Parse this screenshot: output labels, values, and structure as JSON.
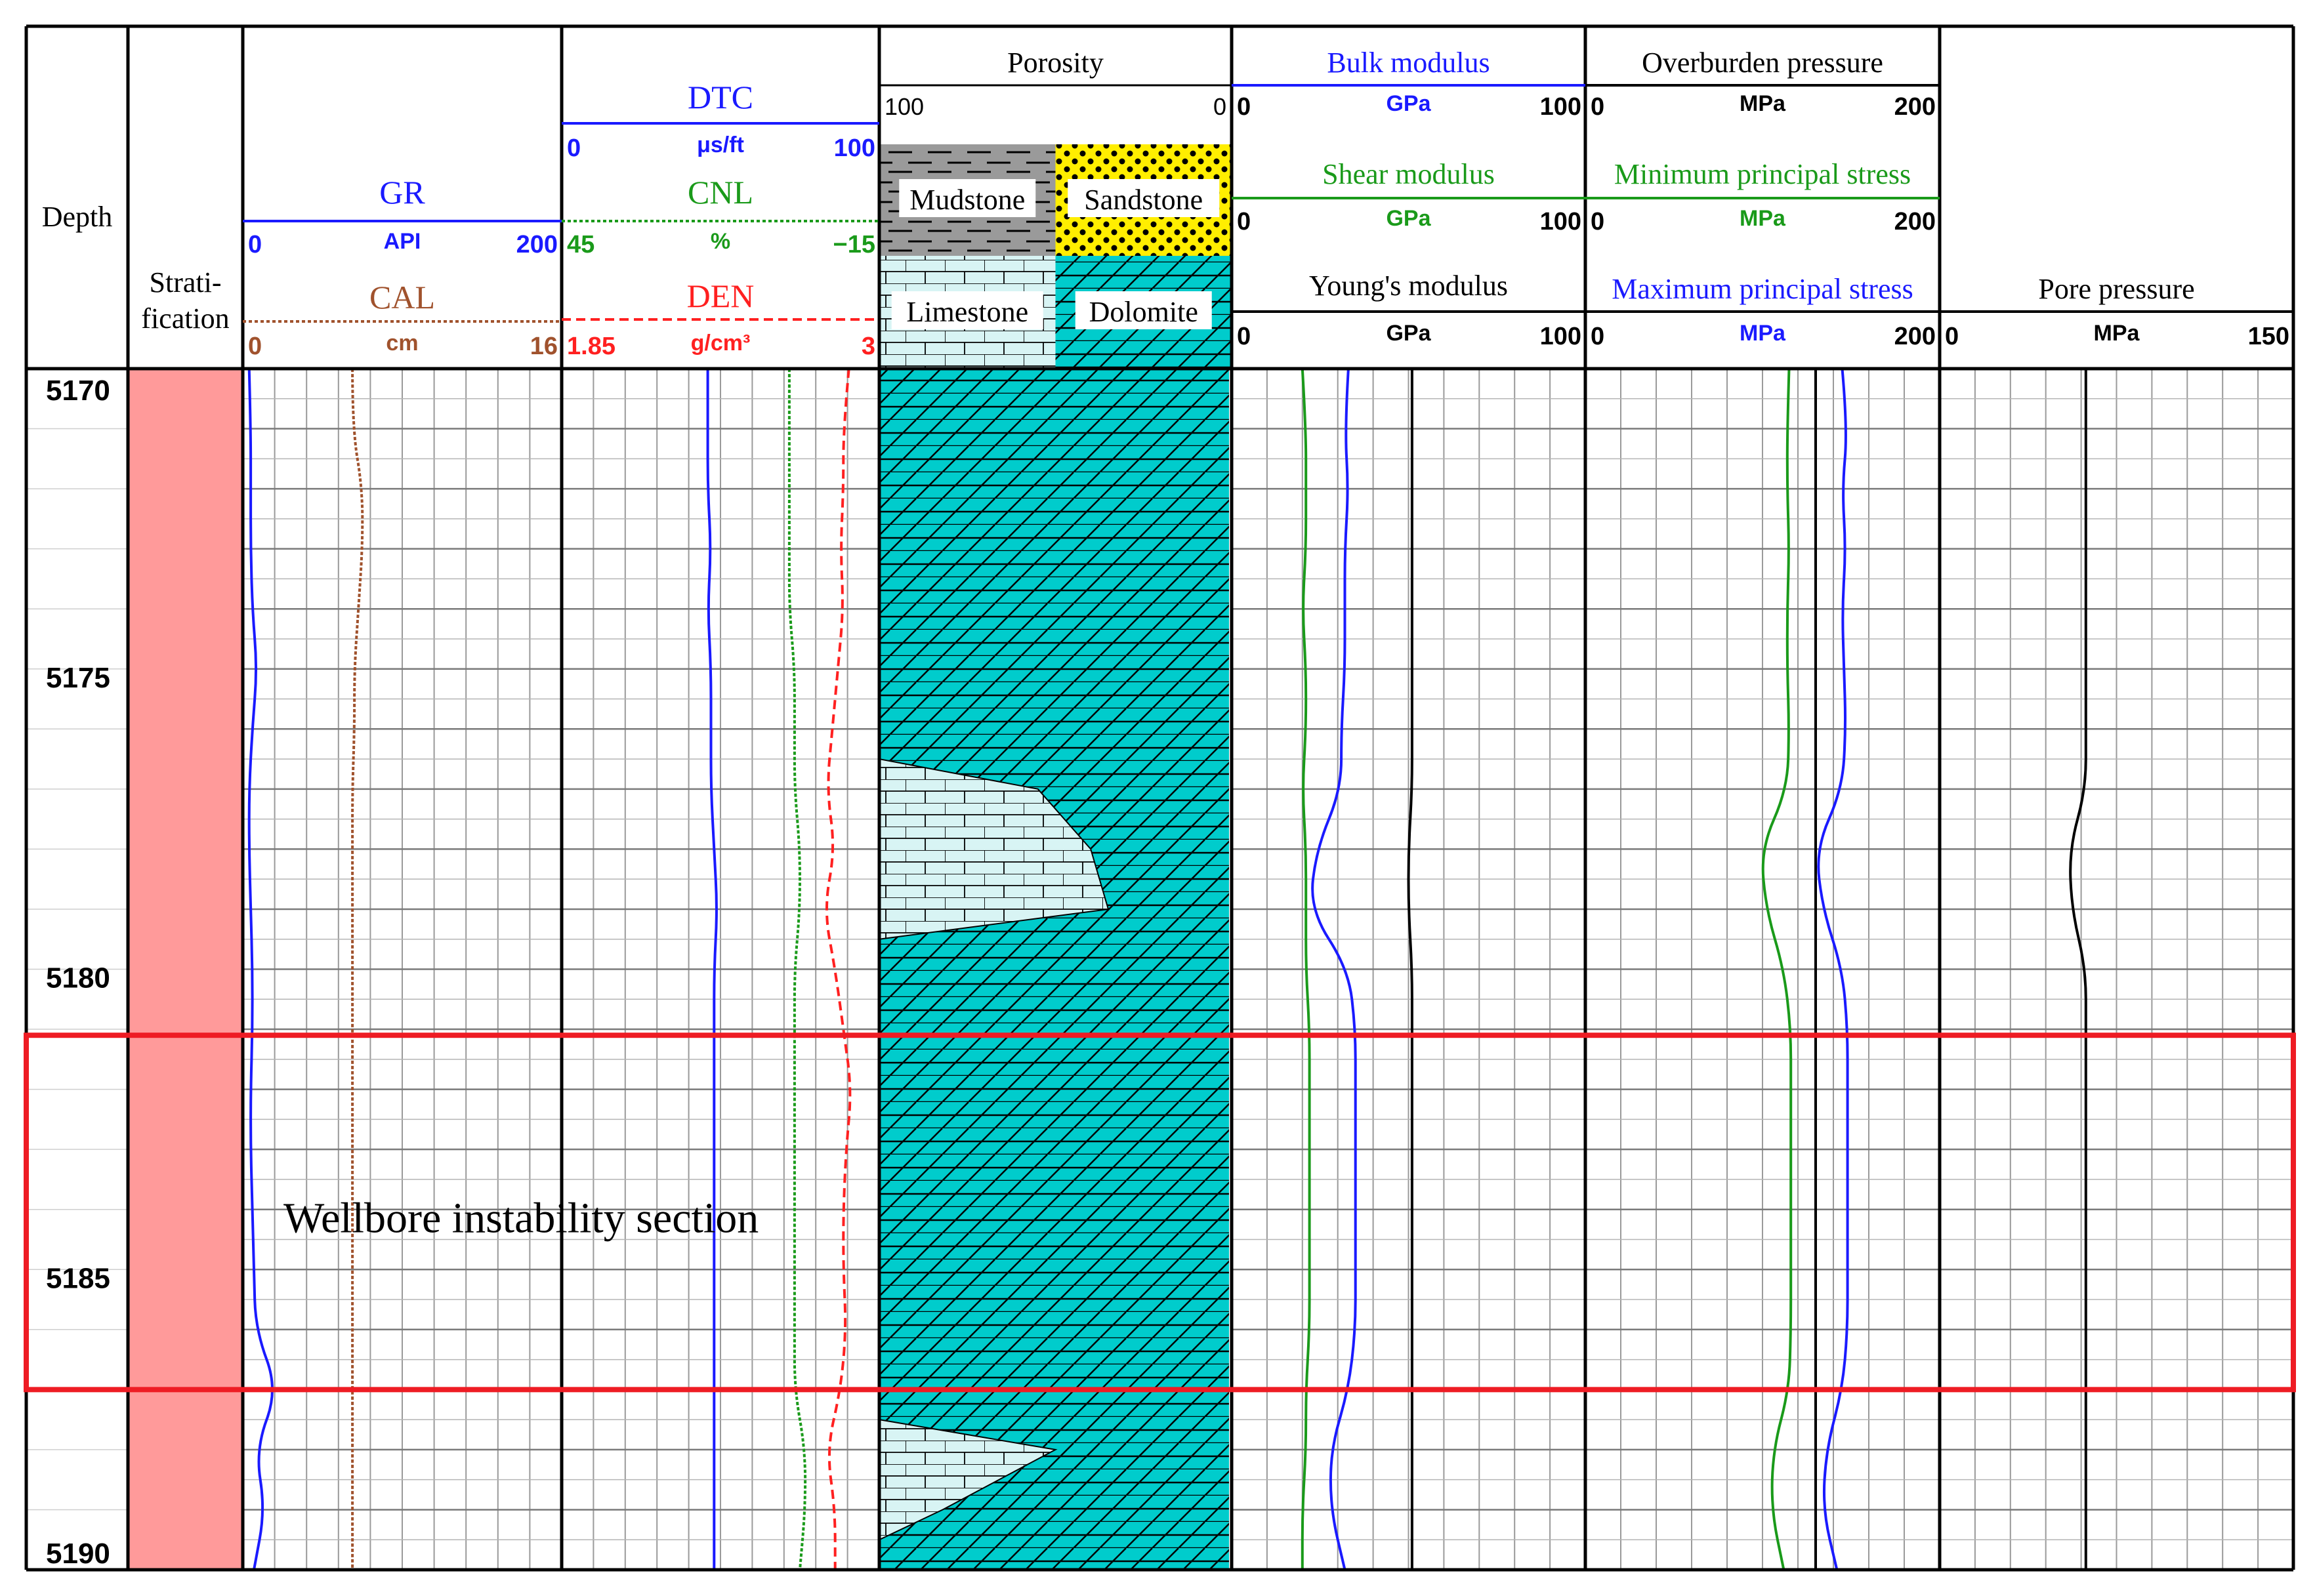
{
  "colors": {
    "gr": "#1a1aff",
    "cal": "#a0522d",
    "dtc": "#1a1aff",
    "cnl": "#1a9a1a",
    "den": "#ff2020",
    "bulk": "#1a1aff",
    "shear": "#1a9a1a",
    "young": "#000000",
    "overburden": "#000000",
    "min_stress": "#1a9a1a",
    "max_stress": "#1a1aff",
    "pore": "#000000",
    "stratification": "#ff9a9a",
    "dolomite_fill": "#00cccc",
    "limestone_fill": "#d8f4f4",
    "mudstone_fill": "#9a9a9a",
    "sandstone_fill": "#ffee00",
    "highlight_box": "#ee1c24"
  },
  "headers": {
    "depth": "Depth",
    "stratification": "Strati-\nfication",
    "porosity": "Porosity",
    "porosity_left": "100",
    "porosity_right": "0",
    "gr": {
      "name": "GR",
      "min": "0",
      "unit": "API",
      "max": "200"
    },
    "cal": {
      "name": "CAL",
      "min": "0",
      "unit": "cm",
      "max": "16"
    },
    "dtc": {
      "name": "DTC",
      "min": "0",
      "unit": "μs/ft",
      "max": "100"
    },
    "cnl": {
      "name": "CNL",
      "min": "45",
      "unit": "%",
      "max": "−15"
    },
    "den": {
      "name": "DEN",
      "min": "1.85",
      "unit": "g/cm³",
      "max": "3"
    },
    "bulk": {
      "name": "Bulk modulus",
      "min": "0",
      "unit": "GPa",
      "max": "100"
    },
    "shear": {
      "name": "Shear modulus",
      "min": "0",
      "unit": "GPa",
      "max": "100"
    },
    "young": {
      "name": "Young's modulus",
      "min": "0",
      "unit": "GPa",
      "max": "100"
    },
    "overburden": {
      "name": "Overburden pressure",
      "min": "0",
      "unit": "MPa",
      "max": "200"
    },
    "min_stress": {
      "name": "Minimum principal stress",
      "min": "0",
      "unit": "MPa",
      "max": "200"
    },
    "max_stress": {
      "name": "Maximum principal stress",
      "min": "0",
      "unit": "MPa",
      "max": "200"
    },
    "pore": {
      "name": "Pore pressure",
      "min": "0",
      "unit": "MPa",
      "max": "150"
    }
  },
  "lithology_legend": [
    "Mudstone",
    "Sandstone",
    "Limestone",
    "Dolomite"
  ],
  "annotation": "Wellbore instability section",
  "chart_data": {
    "type": "line",
    "y_axis": {
      "label": "Depth",
      "range": [
        5170,
        5190
      ],
      "ticks": [
        5170,
        5175,
        5180,
        5185,
        5190
      ]
    },
    "highlight_interval": {
      "label": "Wellbore instability section",
      "top": 5181.1,
      "bottom": 5187.0
    },
    "stratification": {
      "top": 5170,
      "bottom": 5190
    },
    "depth": [
      5170,
      5171,
      5172,
      5173,
      5174,
      5175,
      5176,
      5177,
      5178,
      5179,
      5180,
      5181,
      5182,
      5183,
      5184,
      5185,
      5186,
      5187,
      5188,
      5189,
      5190
    ],
    "series": [
      {
        "name": "GR",
        "track": "gr",
        "unit": "API",
        "range": [
          0,
          200
        ],
        "values": [
          4,
          5,
          5,
          5,
          6,
          9,
          6,
          4,
          4,
          5,
          6,
          6,
          5,
          5,
          6,
          7,
          8,
          22,
          8,
          14,
          7
        ]
      },
      {
        "name": "CAL",
        "track": "gr",
        "unit": "cm",
        "range": [
          0,
          16
        ],
        "values": [
          5.5,
          5.5,
          6.0,
          6.0,
          5.8,
          5.6,
          5.6,
          5.5,
          5.5,
          5.5,
          5.5,
          5.5,
          5.5,
          5.5,
          5.5,
          5.5,
          5.5,
          5.5,
          5.5,
          5.5,
          5.5
        ]
      },
      {
        "name": "DTC",
        "track": "dtc",
        "unit": "μs/ft",
        "range": [
          0,
          100
        ],
        "values": [
          46,
          46,
          46,
          47,
          46,
          47,
          47,
          47,
          48,
          49,
          48,
          48,
          48,
          48,
          48,
          48,
          48,
          48,
          48,
          48,
          48
        ]
      },
      {
        "name": "CNL",
        "track": "dtc",
        "unit": "%",
        "range": [
          45,
          -15
        ],
        "values": [
          2,
          2,
          2,
          2,
          2,
          1,
          1,
          1,
          0,
          0,
          1,
          1,
          1,
          1,
          1,
          1,
          1,
          1,
          -1,
          -1,
          0
        ]
      },
      {
        "name": "DEN",
        "track": "dtc",
        "unit": "g/cm³",
        "range": [
          1.85,
          3
        ],
        "values": [
          2.89,
          2.87,
          2.87,
          2.86,
          2.87,
          2.85,
          2.83,
          2.81,
          2.84,
          2.8,
          2.84,
          2.87,
          2.9,
          2.88,
          2.87,
          2.87,
          2.88,
          2.86,
          2.81,
          2.84,
          2.84
        ]
      },
      {
        "name": "Porosity limestone fraction",
        "track": "lith",
        "unit": "%",
        "range": [
          100,
          0
        ],
        "values": [
          0,
          0,
          0,
          0,
          0,
          0,
          0,
          45,
          60,
          65,
          0,
          0,
          0,
          0,
          0,
          0,
          0,
          0,
          50,
          18,
          0
        ]
      },
      {
        "name": "Bulk modulus",
        "track": "mod",
        "unit": "GPa",
        "range": [
          0,
          100
        ],
        "values": [
          33,
          32,
          33,
          32,
          32,
          32,
          31,
          31,
          24,
          22,
          33,
          35,
          35,
          35,
          35,
          35,
          35,
          33,
          28,
          28,
          32
        ]
      },
      {
        "name": "Shear modulus",
        "track": "mod",
        "unit": "GPa",
        "range": [
          0,
          100
        ],
        "values": [
          20,
          21,
          21,
          21,
          20,
          21,
          21,
          20,
          21,
          21,
          21,
          22,
          22,
          22,
          22,
          22,
          22,
          21,
          21,
          20,
          20
        ]
      },
      {
        "name": "Young's modulus",
        "track": "mod",
        "unit": "GPa",
        "range": [
          0,
          100
        ],
        "values": [
          51,
          51,
          51,
          51,
          51,
          51,
          51,
          51,
          50,
          50,
          51,
          51,
          51,
          51,
          51,
          51,
          51,
          51,
          51,
          51,
          51
        ]
      },
      {
        "name": "Overburden pressure",
        "track": "stress",
        "unit": "MPa",
        "range": [
          0,
          200
        ],
        "values": [
          130,
          130,
          130,
          130,
          130,
          130,
          130,
          130,
          130,
          130,
          130,
          130,
          130,
          130,
          130,
          130,
          130,
          130,
          130,
          130,
          130
        ]
      },
      {
        "name": "Minimum principal stress",
        "track": "stress",
        "unit": "MPa",
        "range": [
          0,
          200
        ],
        "values": [
          115,
          114,
          114,
          115,
          114,
          114,
          115,
          114,
          99,
          102,
          112,
          116,
          116,
          116,
          116,
          116,
          116,
          115,
          106,
          105,
          112
        ]
      },
      {
        "name": "Maximum principal stress",
        "track": "stress",
        "unit": "MPa",
        "range": [
          0,
          200
        ],
        "values": [
          145,
          148,
          145,
          147,
          145,
          146,
          147,
          145,
          130,
          134,
          145,
          148,
          148,
          148,
          148,
          148,
          148,
          145,
          136,
          134,
          142
        ]
      },
      {
        "name": "Pore pressure",
        "track": "pore",
        "unit": "MPa",
        "range": [
          0,
          150
        ],
        "values": [
          62,
          62,
          62,
          62,
          62,
          62,
          62,
          62,
          55,
          56,
          62,
          62,
          62,
          62,
          62,
          62,
          62,
          62,
          62,
          62,
          62
        ]
      }
    ]
  }
}
